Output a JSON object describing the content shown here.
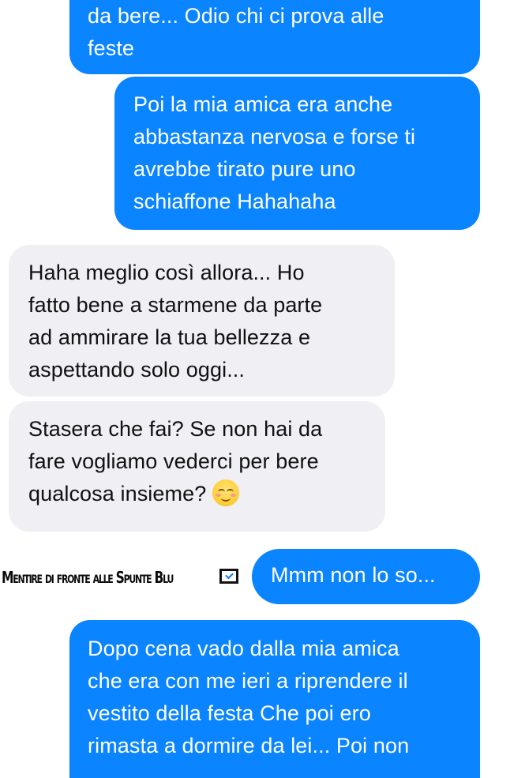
{
  "messages": [
    {
      "direction": "sent",
      "lines": [
        "da bere... Odio chi ci prova alle",
        "feste"
      ]
    },
    {
      "direction": "sent",
      "lines": [
        "Poi la mia amica era anche",
        "abbastanza nervosa e forse ti",
        "avrebbe tirato pure uno",
        "schiaffone Hahahaha"
      ]
    },
    {
      "direction": "received",
      "lines": [
        "Haha meglio così allora... Ho",
        "fatto bene a starmene da parte",
        "ad ammirare la tua bellezza e",
        "aspettando solo oggi..."
      ]
    },
    {
      "direction": "received",
      "lines": [
        "Stasera che fai? Se non hai da",
        "fare vogliamo vederci per bere",
        "qualcosa insieme?"
      ],
      "emoji": "smiling-face-emoji"
    },
    {
      "direction": "sent",
      "lines": [
        "Mmm non lo so..."
      ]
    },
    {
      "direction": "sent",
      "lines": [
        "Dopo cena vado dalla mia amica",
        "che era con me ieri a riprendere il",
        "vestito della festa Che poi ero",
        "rimasta a dormire da lei... Poi non"
      ]
    }
  ],
  "watermark": {
    "text": "Mentire di fronte alle Spunte Blu",
    "icon": "checkbox-icon"
  },
  "colors": {
    "sent_bubble": "#0a84ff",
    "received_bubble": "#efeff4",
    "sent_text": "#ffffff",
    "received_text": "#111111"
  }
}
